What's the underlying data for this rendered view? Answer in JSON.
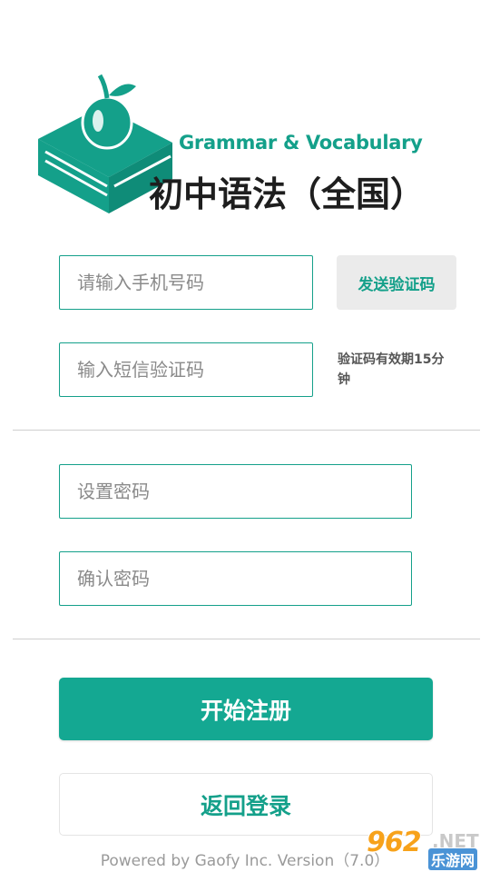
{
  "logo": {
    "english": "Grammar & Vocabulary",
    "chinese": "初中语法（全国）"
  },
  "form": {
    "phone_placeholder": "请输入手机号码",
    "send_code_label": "发送验证码",
    "sms_code_placeholder": "输入短信验证码",
    "code_validity_note": "验证码有效期15分钟",
    "password_placeholder": "设置密码",
    "confirm_password_placeholder": "确认密码"
  },
  "actions": {
    "register_label": "开始注册",
    "back_login_label": "返回登录"
  },
  "footer": {
    "text": "Powered by Gaofy Inc. Version（7.0）"
  },
  "watermark": {
    "number": "962",
    "suffix": ".NET",
    "site_name": "乐游网"
  },
  "colors": {
    "accent": "#14a892",
    "divider": "#cfcfcf",
    "send_code_bg": "#ebebeb"
  }
}
